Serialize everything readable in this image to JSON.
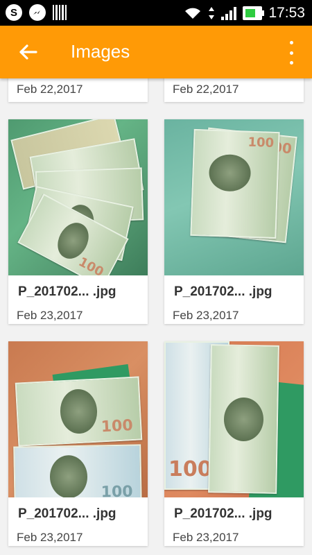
{
  "status_bar": {
    "time": "17:53",
    "left_icons": [
      "skype-icon",
      "messenger-icon",
      "barcode-icon"
    ],
    "right_icons": [
      "wifi-icon",
      "data-arrows-icon",
      "signal-icon",
      "battery-charging-icon"
    ]
  },
  "app_bar": {
    "title": "Images",
    "back_icon": "arrow-left-icon",
    "menu_icon": "more-vertical-icon",
    "color": "#ff9a06"
  },
  "partial_row": [
    {
      "date": "Feb 22,2017"
    },
    {
      "date": "Feb 22,2017"
    }
  ],
  "images": [
    {
      "name": "P_201702... .jpg",
      "date": "Feb 23,2017"
    },
    {
      "name": "P_201702... .jpg",
      "date": "Feb 23,2017"
    },
    {
      "name": "P_201702... .jpg",
      "date": "Feb 23,2017"
    },
    {
      "name": "P_201702... .jpg",
      "date": "Feb 23,2017"
    }
  ]
}
